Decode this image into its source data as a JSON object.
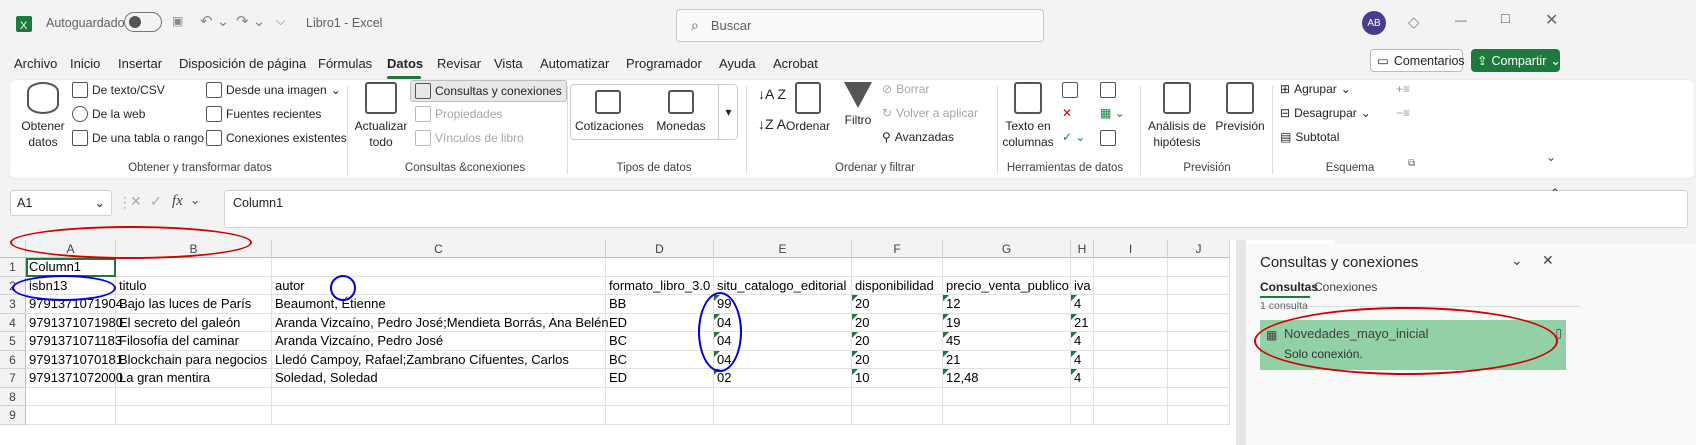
{
  "titlebar": {
    "autosave_label": "Autoguardado",
    "doc_title": "Libro1 - Excel",
    "search_placeholder": "Buscar",
    "avatar_initials": "AB"
  },
  "menu": [
    "Archivo",
    "Inicio",
    "Insertar",
    "Disposición de página",
    "Fórmulas",
    "Datos",
    "Revisar",
    "Vista",
    "Automatizar",
    "Programador",
    "Ayuda",
    "Acrobat"
  ],
  "menu_active": "Datos",
  "menu_right": {
    "comments": "Comentarios",
    "share": "Compartir"
  },
  "ribbon": {
    "get_data": {
      "label1": "Obtener",
      "label2": "datos"
    },
    "from_text": "De texto/CSV",
    "from_web": "De la web",
    "from_table": "De una tabla o rango",
    "from_image": "Desde una imagen",
    "recent_sources": "Fuentes recientes",
    "existing_connections": "Conexiones existentes",
    "group1": "Obtener y transformar datos",
    "refresh": {
      "label1": "Actualizar",
      "label2": "todo"
    },
    "queries_connections": "Consultas y conexiones",
    "properties": "Propiedades",
    "book_links": "Vínculos de libro",
    "group2": "Consultas &conexiones",
    "stocks": "Cotizaciones",
    "currencies": "Monedas",
    "group3": "Tipos de datos",
    "sort": "Ordenar",
    "filter": "Filtro",
    "clear": "Borrar",
    "reapply": "Volver a aplicar",
    "advanced": "Avanzadas",
    "group4": "Ordenar y filtrar",
    "text_to_columns": {
      "label1": "Texto en",
      "label2": "columnas"
    },
    "group5": "Herramientas de datos",
    "what_if": {
      "label1": "Análisis de",
      "label2": "hipótesis"
    },
    "forecast": "Previsión",
    "group6": "Previsión",
    "group_btn": "Agrupar",
    "ungroup_btn": "Desagrupar",
    "subtotal": "Subtotal",
    "group7": "Esquema"
  },
  "formula": {
    "namebox": "A1",
    "content": "Column1"
  },
  "columns": [
    "A",
    "B",
    "C",
    "D",
    "E",
    "F",
    "G",
    "H",
    "I",
    "J"
  ],
  "rows": [
    [
      "Column1",
      "",
      "",
      "",
      "",
      "",
      "",
      ""
    ],
    [
      "isbn13",
      "titulo",
      "autor",
      "formato_libro_3.0",
      "situ_catalogo_editorial",
      "disponibilidad",
      "precio_venta_publico",
      "iva"
    ],
    [
      "9791371071904",
      "Bajo las luces de París",
      "Beaumont, Étienne",
      "BB",
      "99",
      "20",
      "12",
      "4"
    ],
    [
      "9791371071980",
      "El secreto del galeón",
      "Aranda Vizcaíno, Pedro José;Mendieta Borrás, Ana Belén",
      "ED",
      "04",
      "20",
      "19",
      "21"
    ],
    [
      "9791371071183",
      "Filosofía del caminar",
      "Aranda Vizcaíno, Pedro José",
      "BC",
      "04",
      "20",
      "45",
      "4"
    ],
    [
      "9791371070181",
      "Blockchain para negocios",
      "Lledó Campoy, Rafael;Zambrano Cifuentes, Carlos",
      "BC",
      "04",
      "20",
      "21",
      "4"
    ],
    [
      "9791371072000",
      "La gran mentira",
      "Soledad, Soledad",
      "ED",
      "02",
      "10",
      "12,48",
      "4"
    ],
    [
      "",
      "",
      "",
      "",
      "",
      "",
      "",
      ""
    ],
    [
      "",
      "",
      "",
      "",
      "",
      "",
      "",
      ""
    ]
  ],
  "row_numbers": [
    "1",
    "2",
    "3",
    "4",
    "5",
    "6",
    "7",
    "8",
    "9"
  ],
  "pane": {
    "title": "Consultas y conexiones",
    "tab_queries": "Consultas",
    "tab_connections": "Conexiones",
    "count": "1 consulta",
    "query_name": "Novedades_mayo_inicial",
    "query_status": "Solo conexión."
  }
}
